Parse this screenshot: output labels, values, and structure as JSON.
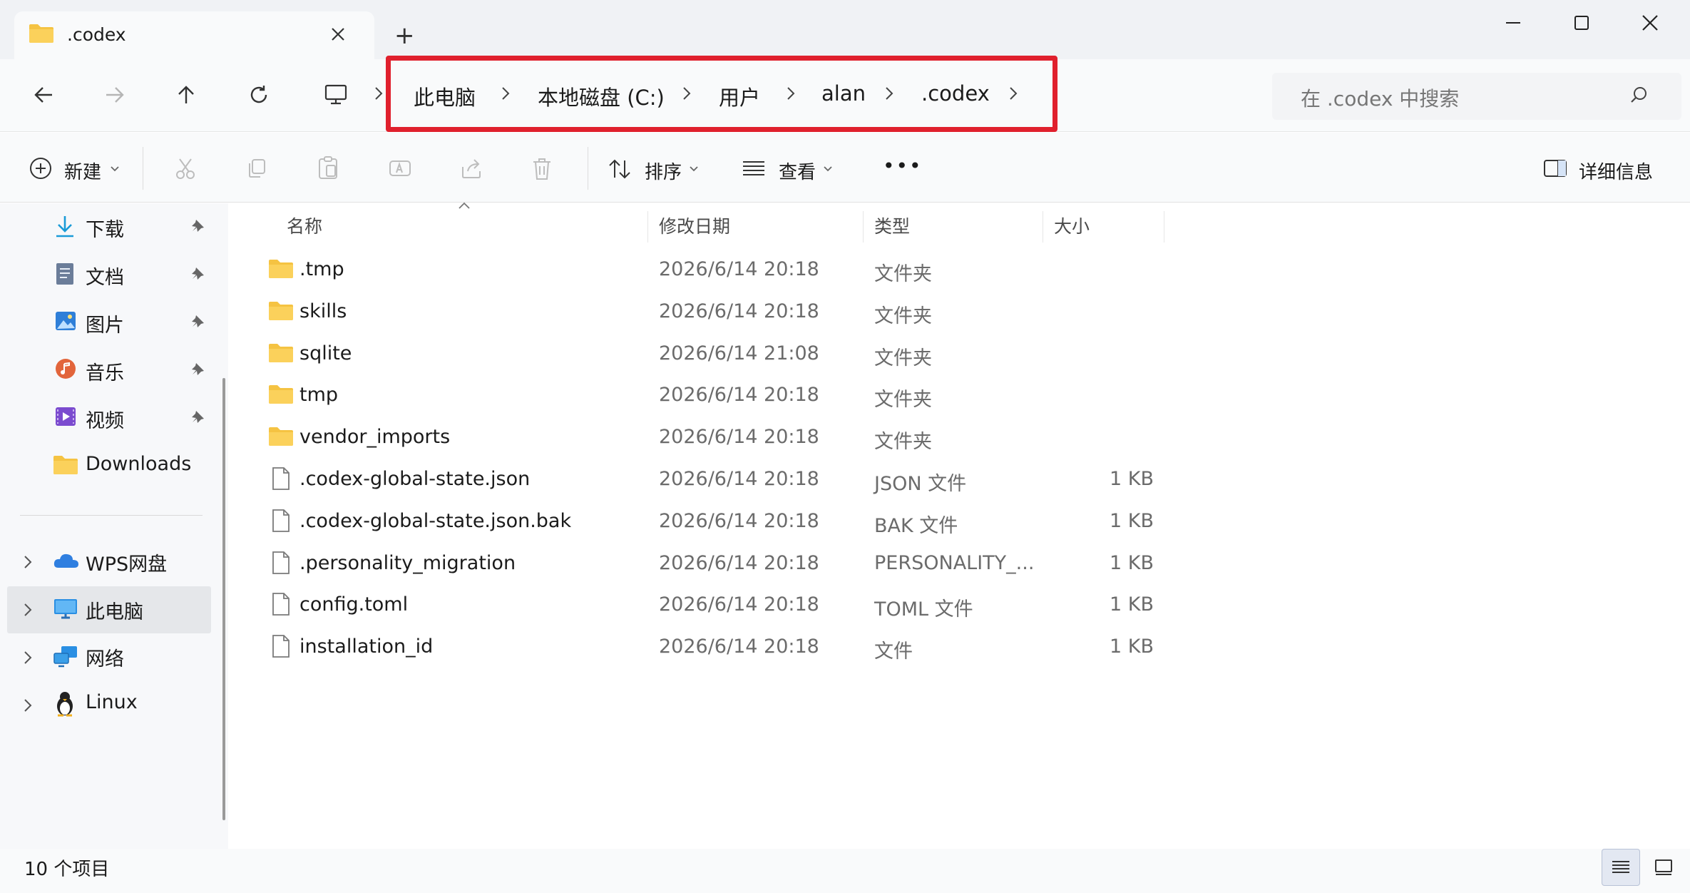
{
  "window": {
    "tab_title": ".codex",
    "new_tab_glyph": "+",
    "controls": [
      "minimize-icon",
      "maximize-icon",
      "close-icon"
    ]
  },
  "address_bar": {
    "breadcrumb": [
      "此电脑",
      "本地磁盘 (C:)",
      "用户",
      "alan",
      ".codex"
    ],
    "search_placeholder": "在 .codex 中搜索",
    "highlight_color": "#e0202d"
  },
  "toolbar": {
    "new_label": "新建",
    "sort_label": "排序",
    "view_label": "查看",
    "more_label": "•••",
    "details_label": "详细信息"
  },
  "sidebar": {
    "quick_access": [
      {
        "label": "下载",
        "icon": "download-icon",
        "pinned": true
      },
      {
        "label": "文档",
        "icon": "document-icon",
        "pinned": true
      },
      {
        "label": "图片",
        "icon": "pictures-icon",
        "pinned": true
      },
      {
        "label": "音乐",
        "icon": "music-icon",
        "pinned": true
      },
      {
        "label": "视频",
        "icon": "video-icon",
        "pinned": true
      },
      {
        "label": "Downloads",
        "icon": "folder-icon",
        "pinned": false
      }
    ],
    "locations": [
      {
        "label": "WPS网盘",
        "icon": "cloud-icon"
      },
      {
        "label": "此电脑",
        "icon": "computer-icon",
        "selected": true
      },
      {
        "label": "网络",
        "icon": "network-icon"
      },
      {
        "label": "Linux",
        "icon": "linux-penguin-icon"
      }
    ]
  },
  "file_list": {
    "columns": [
      "名称",
      "修改日期",
      "类型",
      "大小"
    ],
    "rows": [
      {
        "name": ".tmp",
        "date": "2026/6/14 20:18",
        "type": "文件夹",
        "size": "",
        "kind": "folder"
      },
      {
        "name": "skills",
        "date": "2026/6/14 20:18",
        "type": "文件夹",
        "size": "",
        "kind": "folder"
      },
      {
        "name": "sqlite",
        "date": "2026/6/14 21:08",
        "type": "文件夹",
        "size": "",
        "kind": "folder"
      },
      {
        "name": "tmp",
        "date": "2026/6/14 20:18",
        "type": "文件夹",
        "size": "",
        "kind": "folder"
      },
      {
        "name": "vendor_imports",
        "date": "2026/6/14 20:18",
        "type": "文件夹",
        "size": "",
        "kind": "folder"
      },
      {
        "name": ".codex-global-state.json",
        "date": "2026/6/14 20:18",
        "type": "JSON 文件",
        "size": "1 KB",
        "kind": "file"
      },
      {
        "name": ".codex-global-state.json.bak",
        "date": "2026/6/14 20:18",
        "type": "BAK 文件",
        "size": "1 KB",
        "kind": "file"
      },
      {
        "name": ".personality_migration",
        "date": "2026/6/14 20:18",
        "type": "PERSONALITY_...",
        "size": "1 KB",
        "kind": "file"
      },
      {
        "name": "config.toml",
        "date": "2026/6/14 20:18",
        "type": "TOML 文件",
        "size": "1 KB",
        "kind": "file"
      },
      {
        "name": "installation_id",
        "date": "2026/6/14 20:18",
        "type": "文件",
        "size": "1 KB",
        "kind": "file"
      }
    ]
  },
  "status_bar": {
    "item_count": "10 个项目"
  }
}
